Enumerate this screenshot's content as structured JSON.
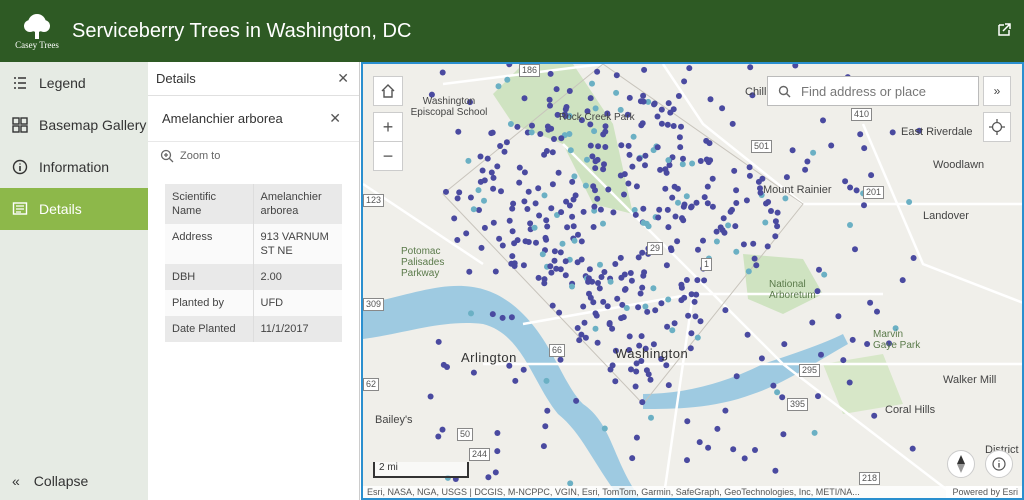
{
  "header": {
    "title": "Serviceberry Trees in Washington, DC",
    "logo_text": "Casey Trees"
  },
  "sidebar": {
    "items": [
      {
        "label": "Legend",
        "icon": "list-icon"
      },
      {
        "label": "Basemap Gallery",
        "icon": "grid-icon"
      },
      {
        "label": "Information",
        "icon": "info-icon"
      },
      {
        "label": "Details",
        "icon": "details-icon",
        "active": true
      }
    ],
    "collapse_label": "Collapse"
  },
  "details": {
    "title": "Details",
    "feature_name": "Amelanchier arborea",
    "zoom_label": "Zoom to",
    "attributes": [
      {
        "name": "Scientific Name",
        "value": "Amelanchier arborea"
      },
      {
        "name": "Address",
        "value": "913 VARNUM ST NE"
      },
      {
        "name": "DBH",
        "value": "2.00"
      },
      {
        "name": "Planted by",
        "value": "UFD"
      },
      {
        "name": "Date Planted",
        "value": "11/1/2017"
      }
    ]
  },
  "map": {
    "search_placeholder": "Find address or place",
    "scale_label": "2 mi",
    "attribution": "Esri, NASA, NGA, USGS | DCGIS, M-NCPPC, VGIN, Esri, TomTom, Garmin, SafeGraph, GeoTechnologies, Inc, METI/NA...",
    "powered_by": "Powered by Esri",
    "places": {
      "washington": "Washington",
      "arlington": "Arlington",
      "washington_episcopal": "Washington Episcopal School",
      "rock_creek": "Rock Creek Park",
      "east_riverdale": "East Riverdale",
      "woodlawn": "Woodlawn",
      "landover": "Landover",
      "mount_rainier": "Mount Rainier",
      "potomac_palisades": "Potomac Palisades Parkway",
      "national_arboretum": "National Arboretum",
      "marvin_gaye": "Marvin Gaye Park",
      "walker_mill": "Walker Mill",
      "coral_hills": "Coral Hills",
      "chillum": "Chill",
      "district_heights": "District H",
      "baileys": "Bailey's"
    },
    "roads": [
      "186",
      "410",
      "501",
      "201",
      "123",
      "309",
      "29",
      "1",
      "66",
      "50",
      "295",
      "395",
      "244",
      "218",
      "62"
    ],
    "colors": {
      "tree_dot": "#4a4aa0",
      "tree_dot_light": "#6bb0c4",
      "water": "#9ecae1",
      "park": "#cfe3c1",
      "accent": "#2e5a24",
      "active": "#8db84a"
    }
  }
}
